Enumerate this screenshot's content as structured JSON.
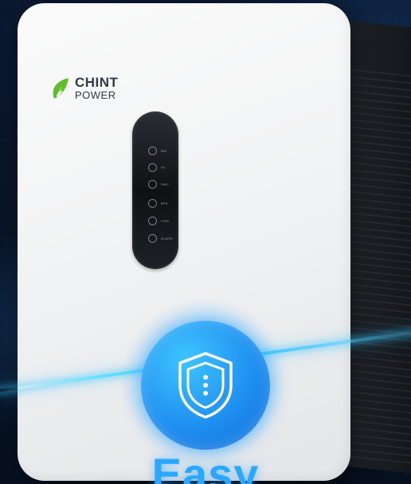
{
  "brand": {
    "name": "CHINT",
    "sub": "POWER",
    "leaf_color": "#5fbf2a"
  },
  "display": {
    "indicators": [
      {
        "icon": "grid-icon",
        "label": "BAT"
      },
      {
        "icon": "pv-icon",
        "label": "PV"
      },
      {
        "icon": "power-icon",
        "label": "SMO"
      },
      {
        "icon": "battery-icon",
        "label": "BPS"
      },
      {
        "icon": "com-icon",
        "label": "COM"
      },
      {
        "icon": "alarm-icon",
        "label": "ALARM"
      }
    ]
  },
  "badge": {
    "icon": "shield-icon",
    "color": "#1f8ff0"
  },
  "heading": {
    "text": "Easy"
  },
  "colors": {
    "accent": "#3ec8ff",
    "background": "#081426",
    "device": "#f2f3f4"
  }
}
